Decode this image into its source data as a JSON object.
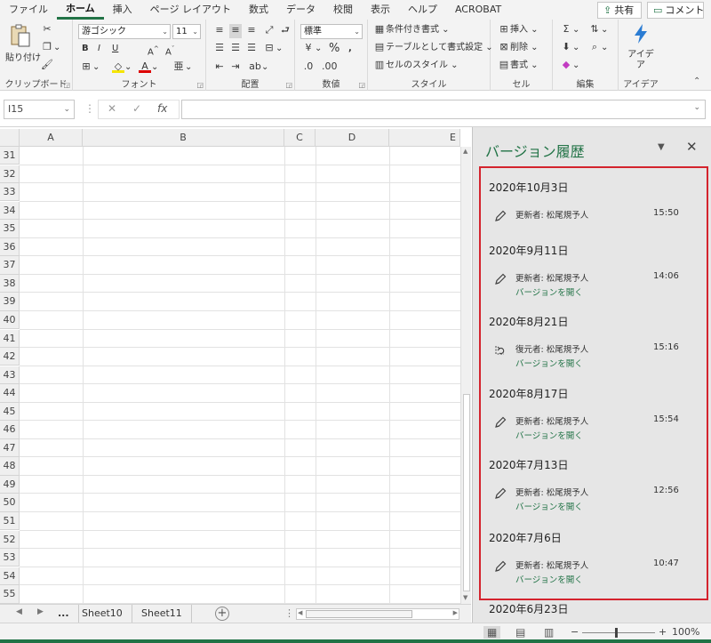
{
  "menu": {
    "tabs": [
      "ファイル",
      "ホーム",
      "挿入",
      "ページ レイアウト",
      "数式",
      "データ",
      "校閲",
      "表示",
      "ヘルプ",
      "ACROBAT"
    ],
    "active": "ホーム",
    "share_label": "共有",
    "comment_label": "コメント"
  },
  "ribbon": {
    "clipboard": {
      "label": "クリップボード",
      "paste_label": "貼り付け"
    },
    "font": {
      "label": "フォント",
      "font_name": "游ゴシック",
      "font_size": "11",
      "bold": "B",
      "italic": "I",
      "underline": "U"
    },
    "alignment": {
      "label": "配置"
    },
    "number": {
      "label": "数値",
      "format": "標準",
      "percent": "%"
    },
    "styles": {
      "label": "スタイル",
      "conditional": "条件付き書式",
      "table": "テーブルとして書式設定",
      "cell_styles": "セルのスタイル"
    },
    "cells": {
      "label": "セル",
      "insert": "挿入",
      "delete": "削除",
      "format": "書式"
    },
    "editing": {
      "label": "編集"
    },
    "ideas": {
      "label": "アイデア",
      "button": "アイデア"
    }
  },
  "formula_bar": {
    "name_box": "I15",
    "value": ""
  },
  "grid": {
    "columns": [
      "A",
      "B",
      "C",
      "D",
      "E"
    ],
    "rows": [
      "31",
      "32",
      "33",
      "34",
      "35",
      "36",
      "37",
      "38",
      "39",
      "40",
      "41",
      "42",
      "43",
      "44",
      "45",
      "46",
      "47",
      "48",
      "49",
      "50",
      "51",
      "52",
      "53",
      "54",
      "55"
    ]
  },
  "sheet_tabs": {
    "ellipsis": "...",
    "tabs": [
      "Sheet10",
      "Sheet11"
    ]
  },
  "status": {
    "zoom": "100%"
  },
  "version_history": {
    "title": "バージョン履歴",
    "open_label": "バージョンを開く",
    "entries": [
      {
        "date": "2020年10月3日",
        "action": "更新者: 松尾規予人",
        "time": "15:50",
        "icon": "pencil-icon",
        "open": false
      },
      {
        "date": "2020年9月11日",
        "action": "更新者: 松尾規予人",
        "time": "14:06",
        "icon": "pencil-icon",
        "open": true
      },
      {
        "date": "2020年8月21日",
        "action": "復元者: 松尾規予人",
        "time": "15:16",
        "icon": "restore-icon",
        "open": true
      },
      {
        "date": "2020年8月17日",
        "action": "更新者: 松尾規予人",
        "time": "15:54",
        "icon": "pencil-icon",
        "open": true
      },
      {
        "date": "2020年7月13日",
        "action": "更新者: 松尾規予人",
        "time": "12:56",
        "icon": "pencil-icon",
        "open": true
      },
      {
        "date": "2020年7月6日",
        "action": "更新者: 松尾規予人",
        "time": "10:47",
        "icon": "pencil-icon",
        "open": true
      },
      {
        "date": "2020年6月23日"
      }
    ]
  }
}
